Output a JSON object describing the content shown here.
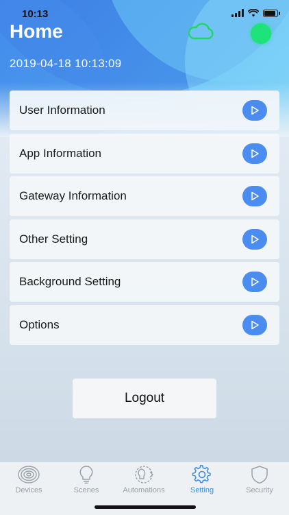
{
  "status_bar": {
    "time": "10:13"
  },
  "header": {
    "title": "Home",
    "timestamp": "2019-04-18 10:13:09",
    "cloud_color": "#1ed760",
    "online_color": "#1ee27a"
  },
  "menu": {
    "items": [
      {
        "label": "User Information"
      },
      {
        "label": "App Information"
      },
      {
        "label": "Gateway Information"
      },
      {
        "label": "Other Setting"
      },
      {
        "label": "Background Setting"
      },
      {
        "label": "Options"
      }
    ]
  },
  "logout_label": "Logout",
  "tabs": [
    {
      "label": "Devices",
      "icon": "devices-icon",
      "active": false
    },
    {
      "label": "Scenes",
      "icon": "lightbulb-icon",
      "active": false
    },
    {
      "label": "Automations",
      "icon": "automation-icon",
      "active": false
    },
    {
      "label": "Setting",
      "icon": "gear-icon",
      "active": true
    },
    {
      "label": "Security",
      "icon": "shield-icon",
      "active": false
    }
  ],
  "colors": {
    "accent": "#3a8be8",
    "arrow_button": "#4b8cf0",
    "inactive_tab": "#9aa0a6"
  }
}
